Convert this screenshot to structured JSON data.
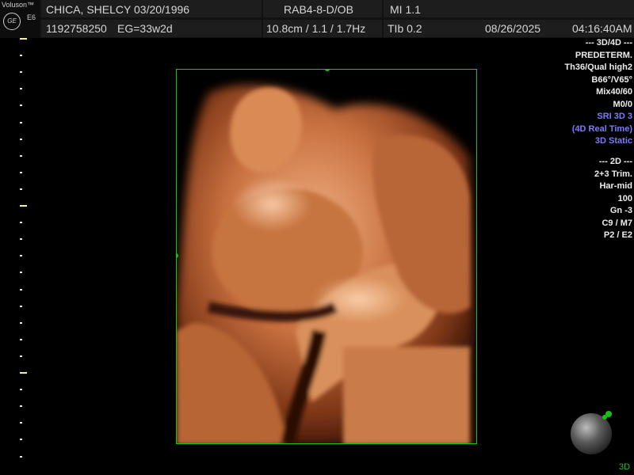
{
  "device": {
    "brand": "Voluson™",
    "model": "E6",
    "logo": "GE"
  },
  "header": {
    "patient": "CHICA, SHELCY 03/20/1996",
    "patient_id": "1192758250",
    "gestation": "EG=33w2d",
    "probe": "RAB4-8-D/OB",
    "depth_info": "10.8cm / 1.1 / 1.7Hz",
    "mi": "MI 1.1",
    "tib": "TIb 0.2",
    "date": "08/26/2025",
    "time": "04:16:40AM"
  },
  "panel_3d4d": [
    {
      "text": "--- 3D/4D ---",
      "color": "white"
    },
    {
      "text": "PREDETERM.",
      "color": "white"
    },
    {
      "text": "Th36/Qual high2",
      "color": "white"
    },
    {
      "text": "B66°/V65°",
      "color": "white"
    },
    {
      "text": "Mix40/60",
      "color": "white"
    },
    {
      "text": "M0/0",
      "color": "white"
    },
    {
      "text": "SRI 3D 3",
      "color": "blue"
    },
    {
      "text": "(4D Real Time)",
      "color": "blue"
    },
    {
      "text": "3D Static",
      "color": "blue"
    }
  ],
  "panel_2d": [
    "--- 2D ---",
    "2+3 Trim.",
    "Har-mid",
    "100",
    "Gn  -3",
    "C9 / M7",
    "P2 / E2"
  ],
  "view_label": "3D",
  "colors": {
    "frame": "#15c515",
    "accent_blue": "#7b7bff",
    "scale_major": "#f5f1a0"
  }
}
